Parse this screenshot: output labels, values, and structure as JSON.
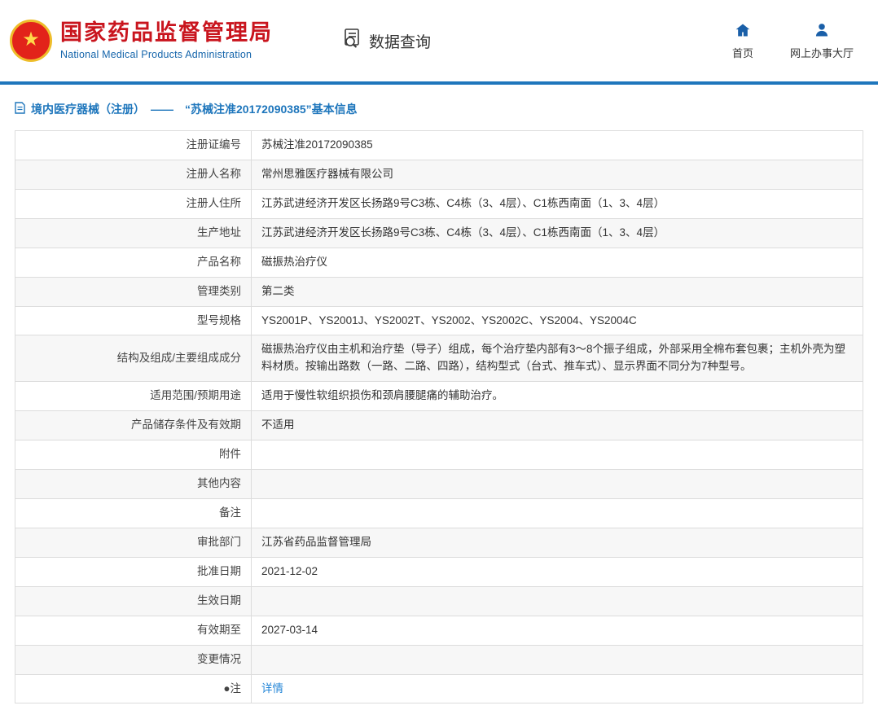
{
  "header": {
    "org_name_cn": "国家药品监督管理局",
    "org_name_en": "National Medical Products Administration",
    "nav_query": "数据查询",
    "nav_home": "首页",
    "nav_hall": "网上办事大厅"
  },
  "breadcrumb": {
    "text": "境内医疗器械（注册）　——　“苏械注准20172090385”基本信息"
  },
  "colors": {
    "accent_blue": "#1e76bc",
    "brand_red": "#c9151e",
    "link_blue": "#2586d7"
  },
  "table": {
    "rows": [
      {
        "label": "注册证编号",
        "value": "苏械注准20172090385"
      },
      {
        "label": "注册人名称",
        "value": "常州思雅医疗器械有限公司"
      },
      {
        "label": "注册人住所",
        "value": "江苏武进经济开发区长扬路9号C3栋、C4栋（3、4层）、C1栋西南面（1、3、4层）"
      },
      {
        "label": "生产地址",
        "value": "江苏武进经济开发区长扬路9号C3栋、C4栋（3、4层）、C1栋西南面（1、3、4层）"
      },
      {
        "label": "产品名称",
        "value": "磁振热治疗仪"
      },
      {
        "label": "管理类别",
        "value": "第二类"
      },
      {
        "label": "型号规格",
        "value": "YS2001P、YS2001J、YS2002T、YS2002、YS2002C、YS2004、YS2004C"
      },
      {
        "label": "结构及组成/主要组成成分",
        "value": "磁振热治疗仪由主机和治疗垫（导子）组成，每个治疗垫内部有3～8个振子组成，外部采用全棉布套包裹；主机外壳为塑料材质。按输出路数（一路、二路、四路），结构型式（台式、推车式）、显示界面不同分为7种型号。"
      },
      {
        "label": "适用范围/预期用途",
        "value": "适用于慢性软组织损伤和颈肩腰腿痛的辅助治疗。"
      },
      {
        "label": "产品储存条件及有效期",
        "value": "不适用"
      },
      {
        "label": "附件",
        "value": ""
      },
      {
        "label": "其他内容",
        "value": ""
      },
      {
        "label": "备注",
        "value": ""
      },
      {
        "label": "审批部门",
        "value": "江苏省药品监督管理局"
      },
      {
        "label": "批准日期",
        "value": "2021-12-02"
      },
      {
        "label": "生效日期",
        "value": ""
      },
      {
        "label": "有效期至",
        "value": "2027-03-14"
      },
      {
        "label": "变更情况",
        "value": ""
      },
      {
        "label": "●注",
        "value": "详情",
        "link": true
      }
    ]
  }
}
